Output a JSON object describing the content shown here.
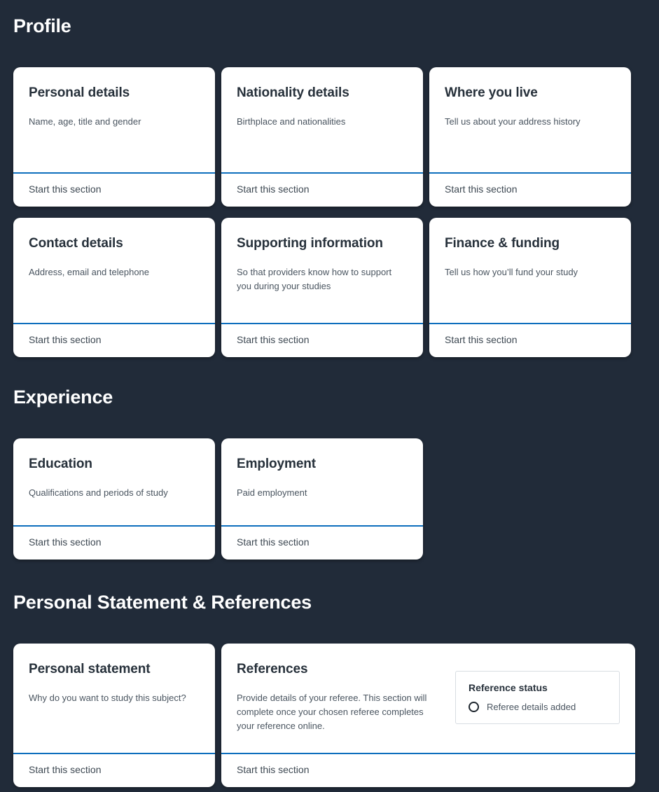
{
  "sections": [
    {
      "heading": "Profile",
      "rows": [
        [
          {
            "title": "Personal details",
            "desc": "Name, age, title and gender",
            "action": "Start this section"
          },
          {
            "title": "Nationality details",
            "desc": "Birthplace and nationalities",
            "action": "Start this section"
          },
          {
            "title": "Where you live",
            "desc": "Tell us about your address history",
            "action": "Start this section"
          }
        ],
        [
          {
            "title": "Contact details",
            "desc": "Address, email and telephone",
            "action": "Start this section"
          },
          {
            "title": "Supporting information",
            "desc": "So that providers know how to support you during your studies",
            "action": "Start this section"
          },
          {
            "title": "Finance & funding",
            "desc": "Tell us how you’ll fund your study",
            "action": "Start this section"
          }
        ]
      ]
    },
    {
      "heading": "Experience",
      "rows": [
        [
          {
            "title": "Education",
            "desc": "Qualifications and periods of study",
            "action": "Start this section"
          },
          {
            "title": "Employment",
            "desc": "Paid employment",
            "action": "Start this section"
          }
        ]
      ]
    },
    {
      "heading": "Personal Statement & References",
      "rows": [
        [
          {
            "title": "Personal statement",
            "desc": "Why do you want to study this subject?",
            "action": "Start this section"
          },
          {
            "title": "References",
            "desc": "Provide details of your referee. This section will complete once your chosen referee completes your reference online.",
            "action": "Start this section",
            "status_panel": {
              "title": "Reference status",
              "option_icon": "radio-unselected-icon",
              "option_label": "Referee details added"
            }
          }
        ]
      ]
    }
  ],
  "colors": {
    "background": "#212b39",
    "card_background": "#ffffff",
    "accent_divider": "#0d6ebd",
    "heading_text": "#ffffff",
    "card_title_text": "#27313b",
    "card_desc_text": "#4a5560",
    "action_text": "#3d4852",
    "status_border": "#d8dde2",
    "radio_ring": "#1d252d"
  }
}
